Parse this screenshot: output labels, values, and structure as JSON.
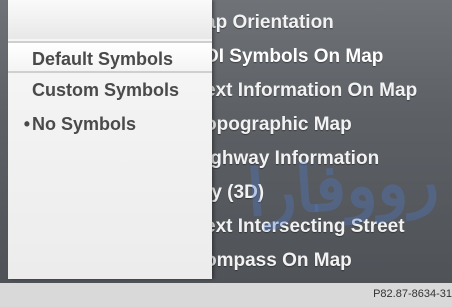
{
  "background_menu": {
    "items": [
      {
        "label": "ap Orientation"
      },
      {
        "label": "DI Symbols On Map"
      },
      {
        "label": "ext Information On Map"
      },
      {
        "label": "opographic Map"
      },
      {
        "label": "ighway Information"
      },
      {
        "label": "ty (3D)"
      },
      {
        "label": "ext Intersecting Street"
      },
      {
        "label": "ompass On Map"
      }
    ]
  },
  "popup": {
    "options": [
      {
        "label": "Default Symbols",
        "bullet": "",
        "state": "highlighted"
      },
      {
        "label": "Custom Symbols",
        "bullet": "",
        "state": "normal"
      },
      {
        "label": "No Symbols",
        "bullet": "•",
        "state": "active"
      }
    ]
  },
  "footer": {
    "code": "P82.87-8634-31"
  },
  "colors": {
    "screen_bg": "#5d6166",
    "popup_bg": "#f2f2f2",
    "menu_text": "#f2f2f2",
    "popup_text": "#4a4a4a",
    "watermark": "#5078c8"
  }
}
